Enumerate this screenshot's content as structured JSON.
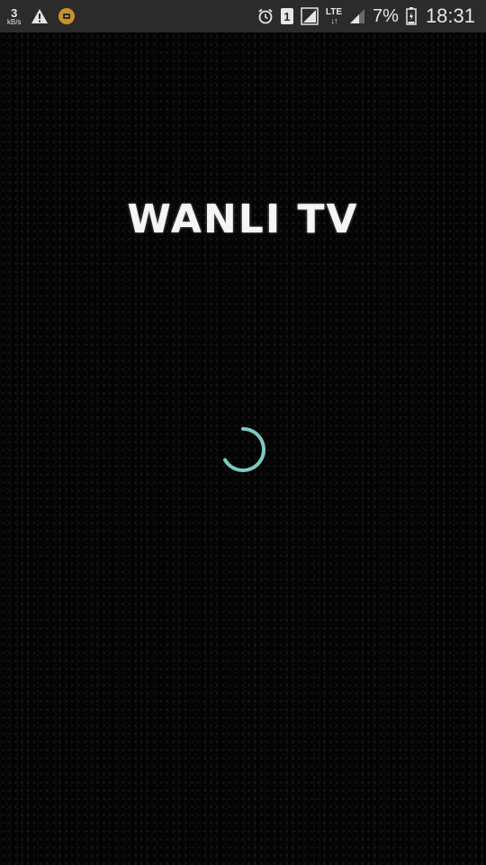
{
  "status_bar": {
    "net_speed_value": "3",
    "net_speed_unit": "kB/s",
    "sim_number": "1",
    "network_type": "LTE",
    "battery_percent": "7%",
    "time": "18:31"
  },
  "app": {
    "title": "WANLI TV"
  },
  "colors": {
    "spinner": "#7ec8c4",
    "background": "#030303",
    "status_bar": "#2b2b2b"
  }
}
